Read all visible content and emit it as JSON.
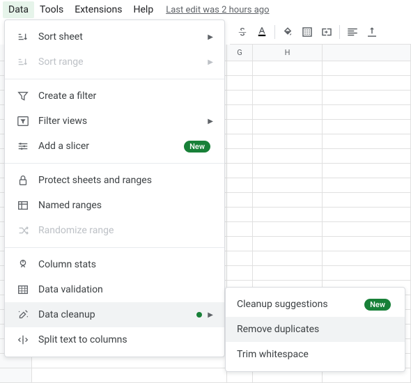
{
  "menubar": {
    "items": [
      "Data",
      "Tools",
      "Extensions",
      "Help"
    ],
    "active_index": 0,
    "last_edit": "Last edit was 2 hours ago"
  },
  "toolbar": {
    "icons": [
      "strikethrough",
      "text-color",
      "fill-color",
      "borders",
      "merge",
      "sep",
      "h-align",
      "v-align"
    ]
  },
  "data_menu": {
    "groups": [
      [
        {
          "icon": "sort-sheet",
          "label": "Sort sheet",
          "arrow": true,
          "disabled": false
        },
        {
          "icon": "sort-range",
          "label": "Sort range",
          "arrow": true,
          "disabled": true
        }
      ],
      [
        {
          "icon": "filter",
          "label": "Create a filter"
        },
        {
          "icon": "filter-views",
          "label": "Filter views",
          "arrow": true
        },
        {
          "icon": "slicer",
          "label": "Add a slicer",
          "badge": "New"
        }
      ],
      [
        {
          "icon": "protect",
          "label": "Protect sheets and ranges"
        },
        {
          "icon": "named-ranges",
          "label": "Named ranges"
        },
        {
          "icon": "randomize",
          "label": "Randomize range",
          "disabled": true
        }
      ],
      [
        {
          "icon": "column-stats",
          "label": "Column stats"
        },
        {
          "icon": "validation",
          "label": "Data validation"
        },
        {
          "icon": "cleanup",
          "label": "Data cleanup",
          "arrow": true,
          "dot": true,
          "highlight": true
        },
        {
          "icon": "split",
          "label": "Split text to columns"
        }
      ]
    ]
  },
  "cleanup_submenu": {
    "items": [
      {
        "label": "Cleanup suggestions",
        "badge": "New"
      },
      {
        "label": "Remove duplicates",
        "highlight": true
      },
      {
        "label": "Trim whitespace"
      }
    ]
  },
  "sheet": {
    "visible_columns": [
      "G",
      "H"
    ]
  }
}
